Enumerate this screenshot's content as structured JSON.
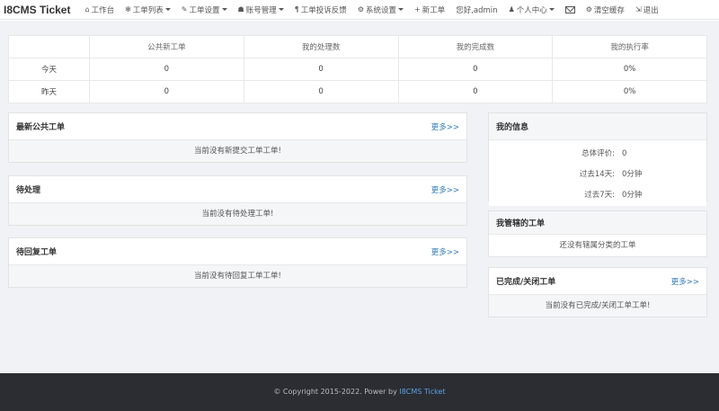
{
  "nav": {
    "brand": "I8CMS Ticket",
    "items": [
      {
        "label": "工作台",
        "icon": "⌂",
        "dropdown": false
      },
      {
        "label": "工单列表",
        "icon": "✻",
        "dropdown": true
      },
      {
        "label": "工单设置",
        "icon": "✎",
        "dropdown": true
      },
      {
        "label": "账号管理",
        "icon": "☗",
        "dropdown": true
      },
      {
        "label": "工单投诉反馈",
        "icon": "¶",
        "dropdown": false
      },
      {
        "label": "系统设置",
        "icon": "⚙",
        "dropdown": true
      },
      {
        "label": "新工单",
        "icon": "+",
        "dropdown": false
      }
    ],
    "welcome": "您好,admin",
    "personal": {
      "label": "个人中心",
      "icon": "♟"
    },
    "message_icon": "envelope-icon",
    "cache": {
      "label": "清空缓存",
      "icon": "⚙"
    },
    "logout": {
      "label": "退出",
      "icon": "⇲"
    }
  },
  "stats": {
    "headers": [
      "",
      "公共新工单",
      "我的处理数",
      "我的完成数",
      "我的执行率"
    ],
    "rows": [
      [
        "今天",
        "0",
        "0",
        "0",
        "0%"
      ],
      [
        "昨天",
        "0",
        "0",
        "0",
        "0%"
      ]
    ]
  },
  "panels": {
    "new_tickets": {
      "title": "最新公共工单",
      "more": "更多>>",
      "empty": "当前没有新提交工单工单!"
    },
    "pending": {
      "title": "待处理",
      "more": "更多>>",
      "empty": "当前没有待处理工单!"
    },
    "to_reply": {
      "title": "待回复工单",
      "more": "更多>>",
      "empty": "当前没有待回复工单工单!"
    },
    "my_info": {
      "title": "我的信息",
      "rows": [
        {
          "k": "总体评价:",
          "v": "0"
        },
        {
          "k": "过去14天:",
          "v": "0分钟"
        },
        {
          "k": "过去7天:",
          "v": "0分钟"
        }
      ]
    },
    "my_managed": {
      "title": "我管辖的工单",
      "empty": "还没有辖属分类的工单"
    },
    "done": {
      "title": "已完成/关闭工单",
      "more": "更多>>",
      "empty": "当前没有已完成/关闭工单工单!"
    }
  },
  "footer": {
    "copyright": "© Copyright 2015-2022. Power by",
    "link": "I8CMS Ticket"
  }
}
